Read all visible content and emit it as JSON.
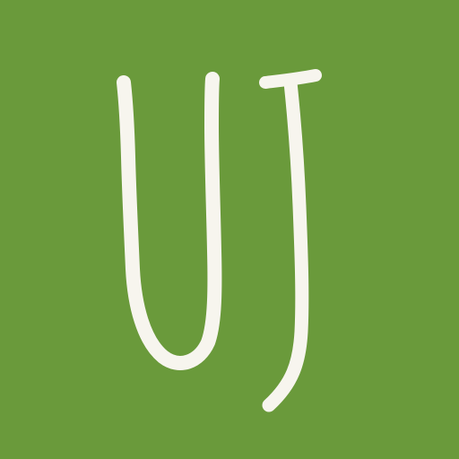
{
  "logo": {
    "monogram_text": "UJ",
    "background_color": "#6a9a3b",
    "stroke_color": "#f7f5ee"
  }
}
